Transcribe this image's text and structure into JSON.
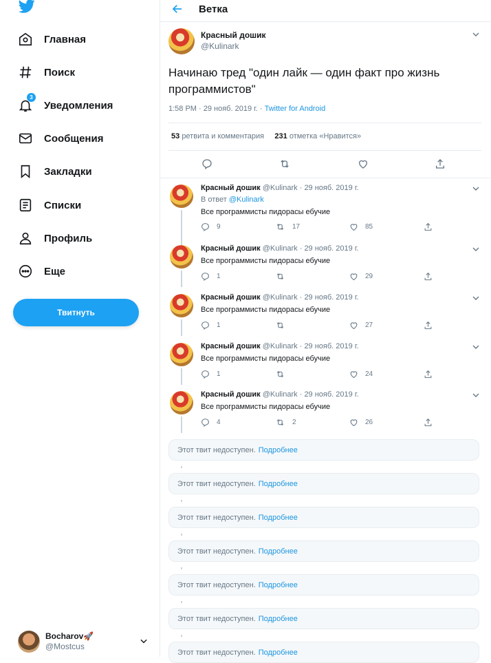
{
  "sidebar": {
    "logo_icon": "twitter-bird-icon",
    "items": [
      {
        "label": "Главная",
        "icon": "home-icon"
      },
      {
        "label": "Поиск",
        "icon": "hashtag-icon"
      },
      {
        "label": "Уведомления",
        "icon": "bell-icon",
        "badge": "3"
      },
      {
        "label": "Сообщения",
        "icon": "envelope-icon"
      },
      {
        "label": "Закладки",
        "icon": "bookmark-icon"
      },
      {
        "label": "Списки",
        "icon": "list-icon"
      },
      {
        "label": "Профиль",
        "icon": "person-icon"
      },
      {
        "label": "Еще",
        "icon": "more-circle-icon"
      }
    ],
    "tweet_button": "Твитнуть",
    "account": {
      "name": "Bocharov🚀",
      "handle": "@Mostcus"
    }
  },
  "header": {
    "title": "Ветка"
  },
  "main_tweet": {
    "name": "Красный дошик",
    "handle": "@Kulinark",
    "text": "Начинаю тред \"один лайк — один факт про жизнь программистов\"",
    "meta": "1:58 PM · 29 нояб. 2019 г. · ",
    "source": "Twitter for Android",
    "retweets_count": "53",
    "retweets_label": "ретвита и комментария",
    "likes_count": "231",
    "likes_label": "отметка «Нравится»"
  },
  "replies": [
    {
      "name": "Красный дошик",
      "handle": "@Kulinark",
      "date": "· 29 нояб. 2019 г.",
      "reply_prefix": "В ответ",
      "reply_to": "@Kulinark",
      "text": "Все программисты пидорасы ебучие",
      "replies": "9",
      "retweets": "17",
      "likes": "85"
    },
    {
      "name": "Красный дошик",
      "handle": "@Kulinark",
      "date": "· 29 нояб. 2019 г.",
      "text": "Все программисты пидорасы ебучие",
      "replies": "1",
      "retweets": "",
      "likes": "29"
    },
    {
      "name": "Красный дошик",
      "handle": "@Kulinark",
      "date": "· 29 нояб. 2019 г.",
      "text": "Все программисты пидорасы ебучие",
      "replies": "1",
      "retweets": "",
      "likes": "27"
    },
    {
      "name": "Красный дошик",
      "handle": "@Kulinark",
      "date": "· 29 нояб. 2019 г.",
      "text": "Все программисты пидорасы ебучие",
      "replies": "1",
      "retweets": "",
      "likes": "24"
    },
    {
      "name": "Красный дошик",
      "handle": "@Kulinark",
      "date": "· 29 нояб. 2019 г.",
      "text": "Все программисты пидорасы ебучие",
      "replies": "4",
      "retweets": "2",
      "likes": "26"
    }
  ],
  "unavailable": [
    {
      "text": "Этот твит недоступен.",
      "link": "Подробнее"
    },
    {
      "text": "Этот твит недоступен.",
      "link": "Подробнее"
    },
    {
      "text": "Этот твит недоступен.",
      "link": "Подробнее"
    },
    {
      "text": "Этот твит недоступен.",
      "link": "Подробнее"
    },
    {
      "text": "Этот твит недоступен.",
      "link": "Подробнее"
    },
    {
      "text": "Этот твит недоступен.",
      "link": "Подробнее"
    },
    {
      "text": "Этот твит недоступен.",
      "link": "Подробнее"
    }
  ],
  "colors": {
    "accent": "#1da1f2",
    "link": "#1b95e0",
    "muted": "#657786"
  }
}
